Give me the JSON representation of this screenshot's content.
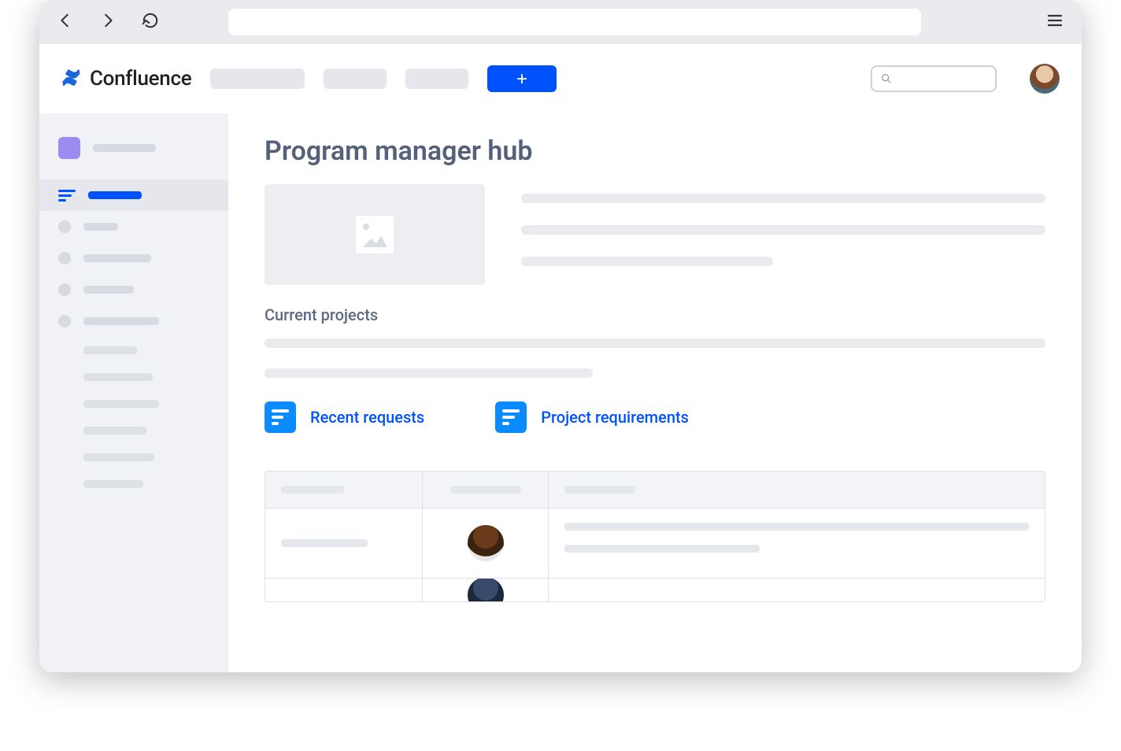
{
  "brand": {
    "name": "Confluence"
  },
  "header": {
    "create_icon": "plus",
    "search_placeholder": ""
  },
  "page": {
    "title": "Program manager hub",
    "section_current_projects": "Current projects",
    "links": [
      {
        "label": "Recent requests"
      },
      {
        "label": "Project requirements"
      }
    ]
  },
  "colors": {
    "primary": "#0052FF",
    "accent": "#0A8BFF",
    "sidebar_highlight": "#9A8CF0"
  }
}
